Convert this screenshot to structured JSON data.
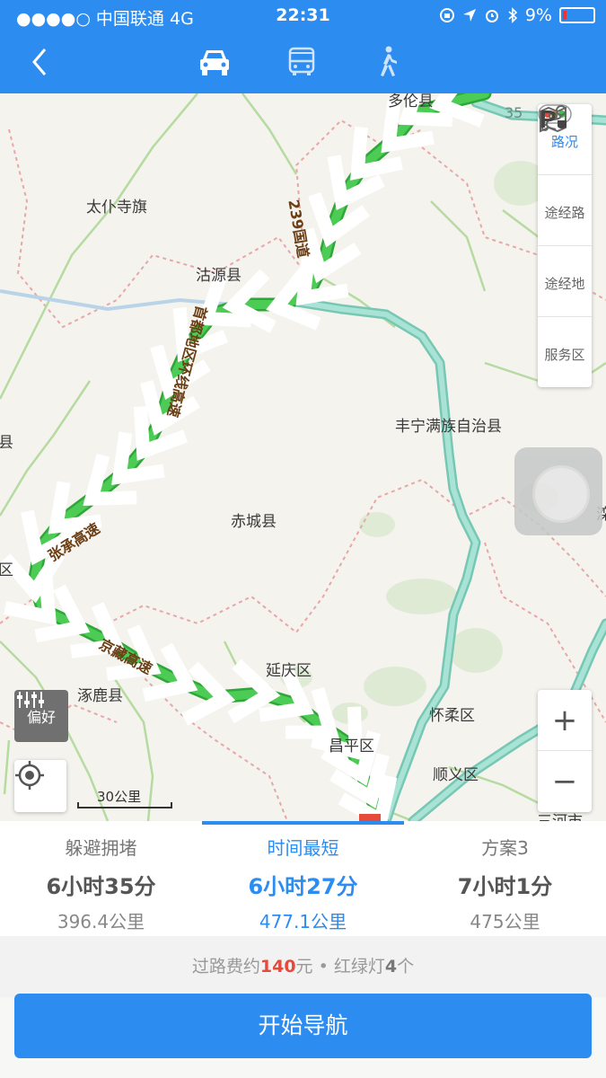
{
  "status_bar": {
    "carrier": "●●●●○ 中国联通",
    "network": "4G",
    "time": "22:31",
    "battery": "9%"
  },
  "nav": {
    "back_icon": "chevron-left-icon",
    "modes": [
      "car-icon",
      "bus-icon",
      "walk-icon"
    ],
    "active_mode": "car"
  },
  "map": {
    "places": [
      "多伦县",
      "太仆寺旗",
      "沽源县",
      "丰宁满族自治县",
      "赤城县",
      "延庆区",
      "涿鹿县",
      "怀柔区",
      "昌平区",
      "顺义区",
      "三河市",
      "县",
      "区",
      "滦"
    ],
    "road_labels": [
      "239国道",
      "首都地区环线高速",
      "张承高速",
      "京藏高速",
      "35"
    ],
    "tools": [
      "路况",
      "途经路",
      "途经地",
      "服务区"
    ],
    "preference": "偏好",
    "scale": "30公里",
    "route_color": "#3dbd4a",
    "alt_route_color": "#8fd7c8"
  },
  "routes": [
    {
      "name": "躲避拥堵",
      "time": "6小时35分",
      "distance": "396.4公里"
    },
    {
      "name": "时间最短",
      "time": "6小时27分",
      "distance": "477.1公里"
    },
    {
      "name": "方案3",
      "time": "7小时1分",
      "distance": "475公里"
    }
  ],
  "active_route_index": 1,
  "trip_info": {
    "toll_prefix": "过路费约",
    "toll_amount": "140",
    "toll_unit": "元",
    "sep": " • ",
    "lights_prefix": "红绿灯",
    "lights_count": "4",
    "lights_unit": "个"
  },
  "start_button": "开始导航"
}
